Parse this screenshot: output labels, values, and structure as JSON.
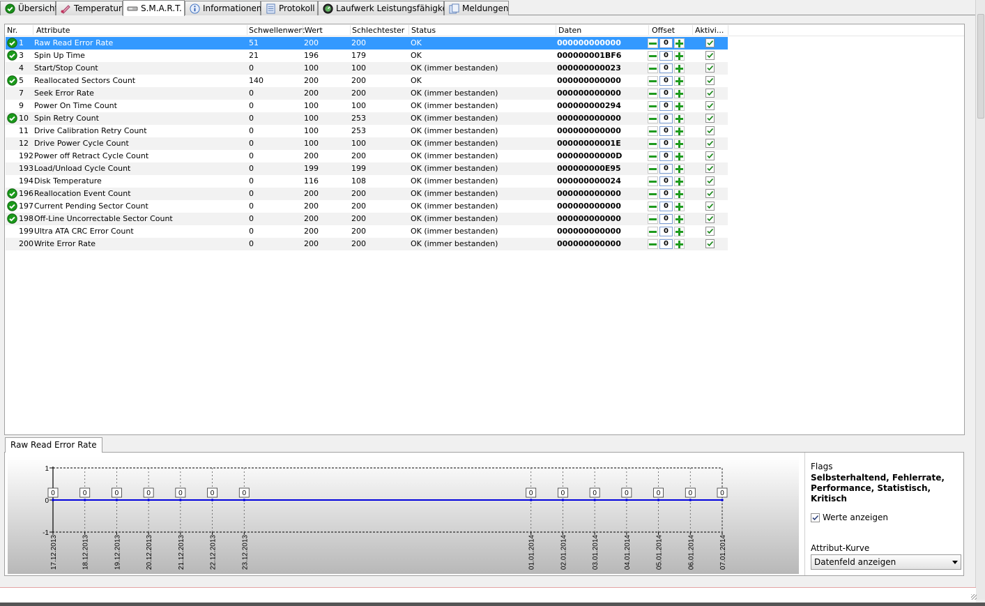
{
  "tabs": [
    {
      "label": "Übersicht",
      "icon": "check-circle-icon",
      "active": false
    },
    {
      "label": "Temperatur",
      "icon": "thermometer-icon",
      "active": false
    },
    {
      "label": "S.M.A.R.T.",
      "icon": "smart-drive-icon",
      "active": true
    },
    {
      "label": "Informationen",
      "icon": "info-icon",
      "active": false
    },
    {
      "label": "Protokoll",
      "icon": "log-document-icon",
      "active": false
    },
    {
      "label": "Laufwerk Leistungsfähigkeit",
      "icon": "performance-gauge-icon",
      "active": false
    },
    {
      "label": "Meldungen",
      "icon": "messages-icon",
      "active": false
    }
  ],
  "table": {
    "columns": [
      "Nr.",
      "Attribute",
      "Schwellenwert",
      "Wert",
      "Schlechtester",
      "Status",
      "Daten",
      "Offset",
      "Aktivi..."
    ],
    "rows": [
      {
        "nr": "1",
        "attribute": "Raw Read Error Rate",
        "threshold": "51",
        "value": "200",
        "worst": "200",
        "status": "OK",
        "data": "000000000000",
        "offset": "0",
        "ok_icon": true,
        "active": true,
        "selected": true
      },
      {
        "nr": "3",
        "attribute": "Spin Up Time",
        "threshold": "21",
        "value": "196",
        "worst": "179",
        "status": "OK",
        "data": "000000001BF6",
        "offset": "0",
        "ok_icon": true,
        "active": true
      },
      {
        "nr": "4",
        "attribute": "Start/Stop Count",
        "threshold": "0",
        "value": "100",
        "worst": "100",
        "status": "OK (immer bestanden)",
        "data": "000000000023",
        "offset": "0",
        "ok_icon": false,
        "active": true
      },
      {
        "nr": "5",
        "attribute": "Reallocated Sectors Count",
        "threshold": "140",
        "value": "200",
        "worst": "200",
        "status": "OK",
        "data": "000000000000",
        "offset": "0",
        "ok_icon": true,
        "active": true
      },
      {
        "nr": "7",
        "attribute": "Seek Error Rate",
        "threshold": "0",
        "value": "200",
        "worst": "200",
        "status": "OK (immer bestanden)",
        "data": "000000000000",
        "offset": "0",
        "ok_icon": false,
        "active": true
      },
      {
        "nr": "9",
        "attribute": "Power On Time Count",
        "threshold": "0",
        "value": "100",
        "worst": "100",
        "status": "OK (immer bestanden)",
        "data": "000000000294",
        "offset": "0",
        "ok_icon": false,
        "active": true
      },
      {
        "nr": "10",
        "attribute": "Spin Retry Count",
        "threshold": "0",
        "value": "100",
        "worst": "253",
        "status": "OK (immer bestanden)",
        "data": "000000000000",
        "offset": "0",
        "ok_icon": true,
        "active": true
      },
      {
        "nr": "11",
        "attribute": "Drive Calibration Retry Count",
        "threshold": "0",
        "value": "100",
        "worst": "253",
        "status": "OK (immer bestanden)",
        "data": "000000000000",
        "offset": "0",
        "ok_icon": false,
        "active": true
      },
      {
        "nr": "12",
        "attribute": "Drive Power Cycle Count",
        "threshold": "0",
        "value": "100",
        "worst": "100",
        "status": "OK (immer bestanden)",
        "data": "00000000001E",
        "offset": "0",
        "ok_icon": false,
        "active": true
      },
      {
        "nr": "192",
        "attribute": "Power off Retract Cycle Count",
        "threshold": "0",
        "value": "200",
        "worst": "200",
        "status": "OK (immer bestanden)",
        "data": "00000000000D",
        "offset": "0",
        "ok_icon": false,
        "active": true
      },
      {
        "nr": "193",
        "attribute": "Load/Unload Cycle Count",
        "threshold": "0",
        "value": "199",
        "worst": "199",
        "status": "OK (immer bestanden)",
        "data": "000000000E95",
        "offset": "0",
        "ok_icon": false,
        "active": true
      },
      {
        "nr": "194",
        "attribute": "Disk Temperature",
        "threshold": "0",
        "value": "116",
        "worst": "108",
        "status": "OK (immer bestanden)",
        "data": "000000000024",
        "offset": "0",
        "ok_icon": false,
        "active": true
      },
      {
        "nr": "196",
        "attribute": "Reallocation Event Count",
        "threshold": "0",
        "value": "200",
        "worst": "200",
        "status": "OK (immer bestanden)",
        "data": "000000000000",
        "offset": "0",
        "ok_icon": true,
        "active": true
      },
      {
        "nr": "197",
        "attribute": "Current Pending Sector Count",
        "threshold": "0",
        "value": "200",
        "worst": "200",
        "status": "OK (immer bestanden)",
        "data": "000000000000",
        "offset": "0",
        "ok_icon": true,
        "active": true
      },
      {
        "nr": "198",
        "attribute": "Off-Line Uncorrectable Sector Count",
        "threshold": "0",
        "value": "200",
        "worst": "200",
        "status": "OK (immer bestanden)",
        "data": "000000000000",
        "offset": "0",
        "ok_icon": true,
        "active": true
      },
      {
        "nr": "199",
        "attribute": "Ultra ATA CRC Error Count",
        "threshold": "0",
        "value": "200",
        "worst": "200",
        "status": "OK (immer bestanden)",
        "data": "000000000000",
        "offset": "0",
        "ok_icon": false,
        "active": true
      },
      {
        "nr": "200",
        "attribute": "Write Error Rate",
        "threshold": "0",
        "value": "200",
        "worst": "200",
        "status": "OK (immer bestanden)",
        "data": "000000000000",
        "offset": "0",
        "ok_icon": false,
        "active": true
      }
    ]
  },
  "detail": {
    "tab_label": "Raw Read Error Rate",
    "flags_title": "Flags",
    "flags_value": "Selbsterhaltend, Fehlerrate, Performance, Statistisch, Kritisch",
    "show_values_label": "Werte anzeigen",
    "show_values_checked": true,
    "curve_label": "Attribut-Kurve",
    "curve_selected": "Datenfeld anzeigen"
  },
  "chart_data": {
    "type": "line",
    "x": [
      "17.12.2013",
      "18.12.2013",
      "19.12.2013",
      "20.12.2013",
      "21.12.2013",
      "22.12.2013",
      "23.12.2013",
      "01.01.2014",
      "02.01.2014",
      "03.01.2014",
      "04.01.2014",
      "05.01.2014",
      "06.01.2014",
      "07.01.2014"
    ],
    "series": [
      {
        "values": [
          0,
          0,
          0,
          0,
          0,
          0,
          0,
          0,
          0,
          0,
          0,
          0,
          0,
          0
        ],
        "color": "#0000dd"
      }
    ],
    "data_labels": [
      "0",
      "0",
      "0",
      "0",
      "0",
      "0",
      "0",
      "0",
      "0",
      "0",
      "0",
      "0",
      "0",
      "0"
    ],
    "yticks": [
      "1",
      "0",
      "-1"
    ],
    "ylim": [
      -1,
      1
    ],
    "grid": true,
    "x_axis": "time"
  },
  "colors": {
    "selection": "#3399ff",
    "ok_green": "#1a9a1a",
    "line": "#0000dd"
  }
}
